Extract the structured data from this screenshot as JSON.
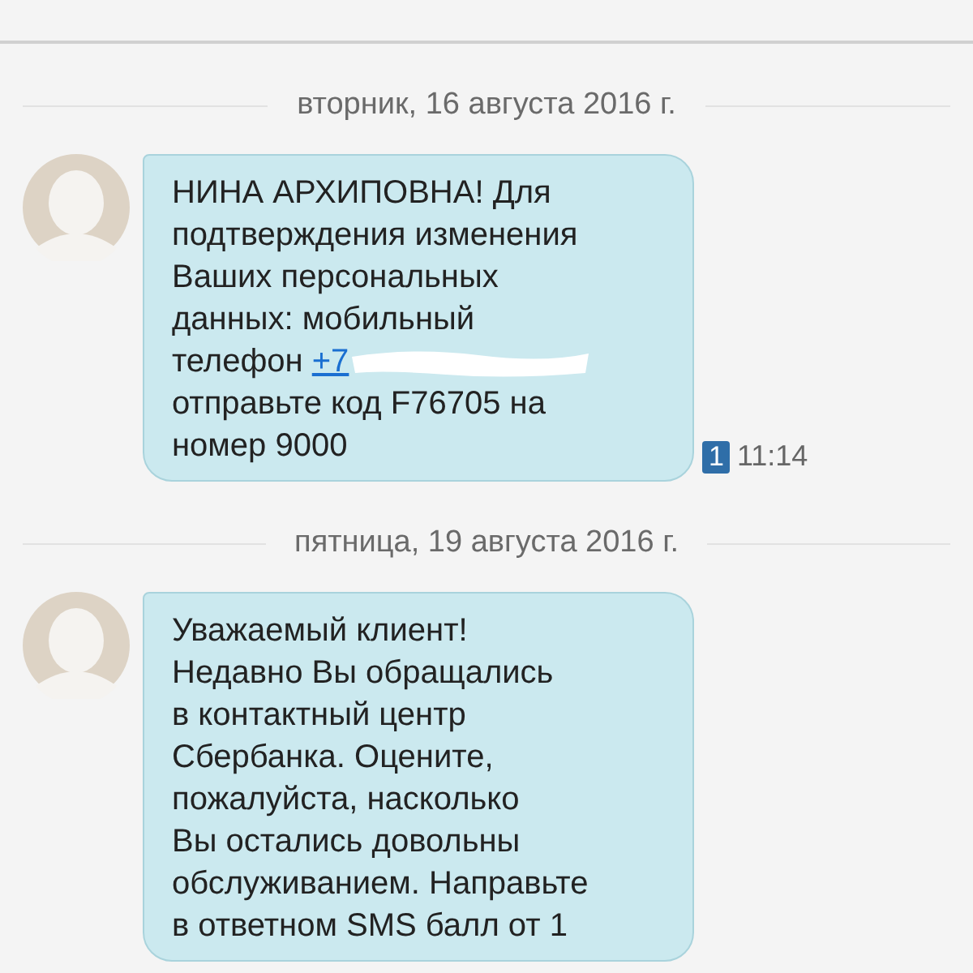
{
  "conversation": [
    {
      "kind": "date",
      "text": "вторник, 16 августа 2016 г."
    },
    {
      "kind": "message",
      "parts": [
        {
          "kind": "text",
          "text": "НИНА АРХИПОВНА! Для\nподтверждения изменения\nВаших персональных\nданных: мобильный\nтелефон "
        },
        {
          "kind": "link",
          "text": "+7",
          "redacted": true
        },
        {
          "kind": "text",
          "text": "\nотправьте код F76705 на\nномер 9000"
        }
      ],
      "sim": "1",
      "time": "11:14"
    },
    {
      "kind": "date",
      "text": "пятница, 19 августа 2016 г."
    },
    {
      "kind": "message",
      "parts": [
        {
          "kind": "text",
          "text": "Уважаемый клиент!\nНедавно Вы обращались\nв контактный центр\nСбербанка. Оцените,\nпожалуйста, насколько\nВы остались довольны\nобслуживанием. Направьте\nв ответном SMS балл от 1"
        }
      ]
    }
  ]
}
